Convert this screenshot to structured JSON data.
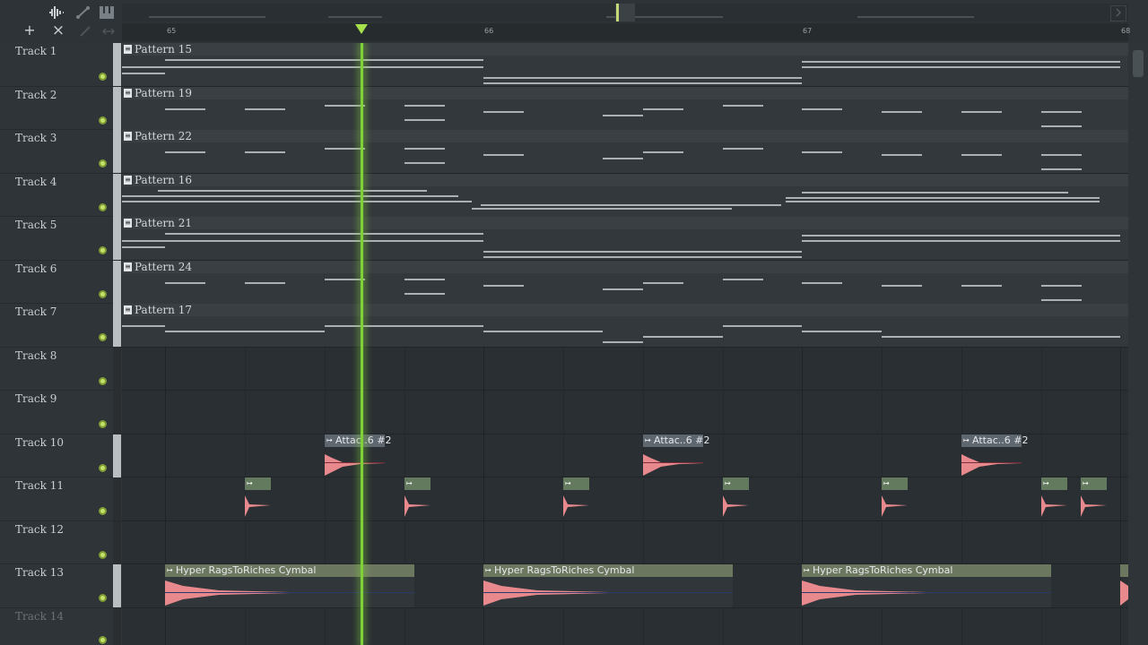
{
  "toolbar": {
    "icons": [
      "waveform-icon",
      "curve-icon",
      "piano-icon",
      "plus-icon",
      "close-icon",
      "brush-icon",
      "slide-icon"
    ],
    "add_symbol": "+",
    "close_symbol": "×"
  },
  "ruler": {
    "bars": [
      "65",
      "66",
      "67",
      "68"
    ]
  },
  "tracks": [
    {
      "name": "Track 1"
    },
    {
      "name": "Track 2"
    },
    {
      "name": "Track 3"
    },
    {
      "name": "Track 4"
    },
    {
      "name": "Track 5"
    },
    {
      "name": "Track 6"
    },
    {
      "name": "Track 7"
    },
    {
      "name": "Track 8"
    },
    {
      "name": "Track 9"
    },
    {
      "name": "Track 10"
    },
    {
      "name": "Track 11"
    },
    {
      "name": "Track 12"
    },
    {
      "name": "Track 13"
    },
    {
      "name": "Track 14"
    }
  ],
  "patterns": [
    {
      "label": "Pattern 15"
    },
    {
      "label": "Pattern 19"
    },
    {
      "label": "Pattern 22"
    },
    {
      "label": "Pattern 16"
    },
    {
      "label": "Pattern 21"
    },
    {
      "label": "Pattern 24"
    },
    {
      "label": "Pattern 17"
    }
  ],
  "audio_clips": {
    "track10_label": "Attac..6 #2",
    "track13_label": "Hyper RagsToRiches Cymbal"
  },
  "colors": {
    "playhead": "#7fd13a",
    "track_led": "#c4e36a",
    "waveform": "#e8898d"
  }
}
